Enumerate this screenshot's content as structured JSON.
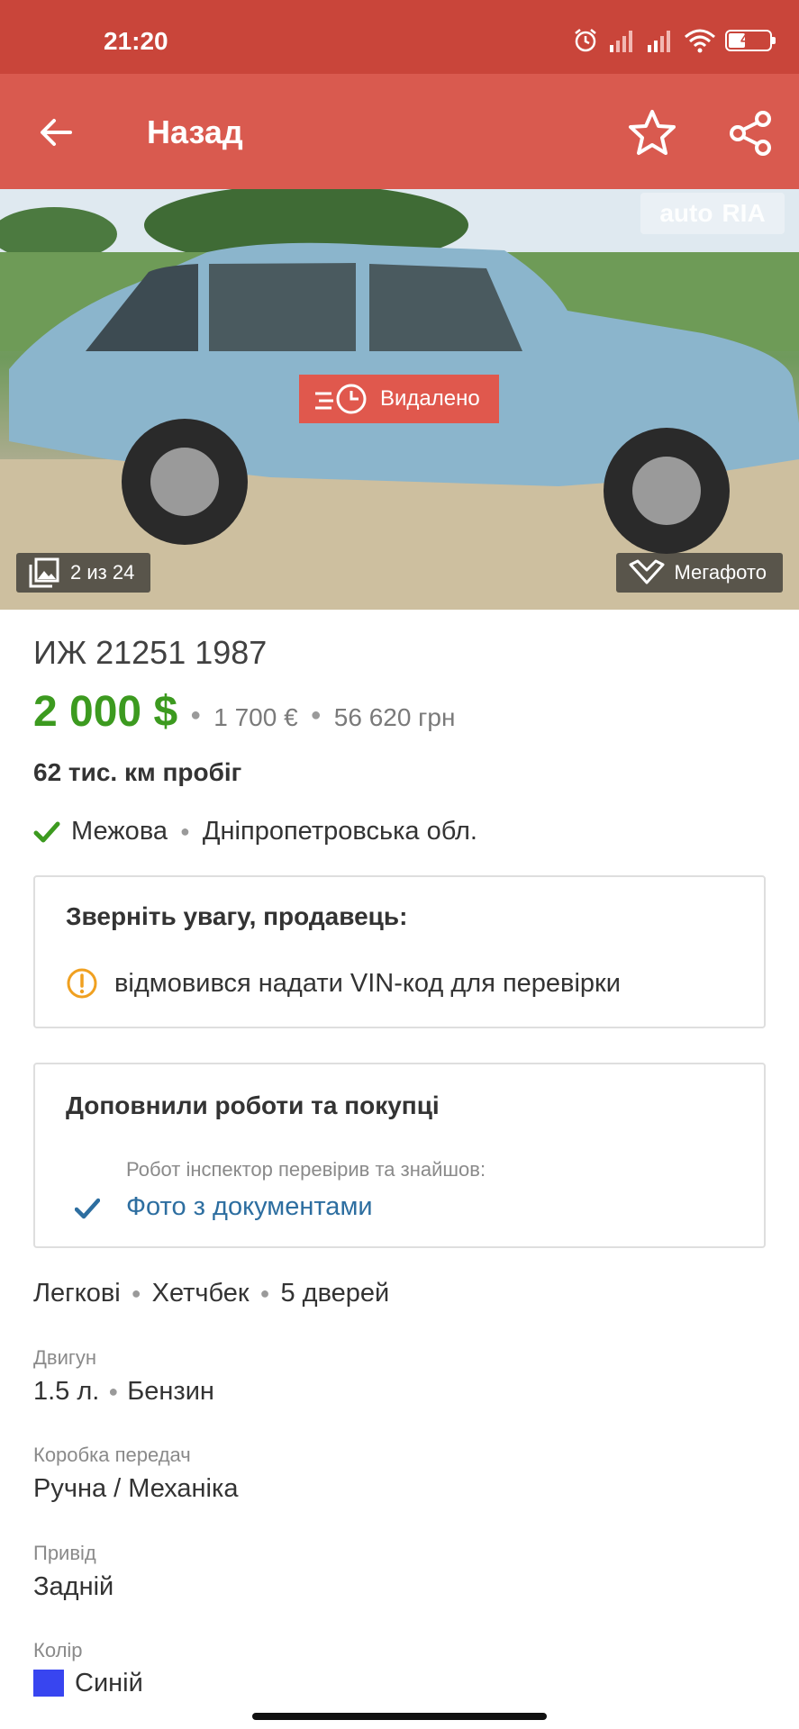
{
  "status_bar": {
    "time": "21:20",
    "battery": "41",
    "battery_level": 0.41
  },
  "app_bar": {
    "title": "Назад",
    "back_icon": "arrow-left-icon",
    "favorite_icon": "star-outline-icon",
    "share_icon": "share-icon"
  },
  "photo": {
    "watermark_left": "auto",
    "watermark_right": "RIA",
    "status_badge": "Видалено",
    "counter": "2 из 24",
    "megaphoto": "Мегафото"
  },
  "listing": {
    "title": "ИЖ 21251 1987",
    "price_main": "2 000 $",
    "price_eur": "1 700 €",
    "price_uah": "56 620 грн",
    "mileage": "62 тис. км пробіг",
    "city": "Межова",
    "region": "Дніпропетровська обл."
  },
  "seller_notice": {
    "heading": "Зверніть увагу, продавець:",
    "item": "відмовився надати VIN-код для перевірки"
  },
  "inspection": {
    "heading": "Доповнили роботи та покупці",
    "subtitle": "Робот інспектор перевірив та знайшов:",
    "link": "Фото з документами"
  },
  "specs": {
    "category": "Легкові",
    "body": "Хетчбек",
    "doors": "5 дверей",
    "engine_label": "Двигун",
    "engine_volume": "1.5 л.",
    "fuel": "Бензин",
    "gearbox_label": "Коробка передач",
    "gearbox": "Ручна / Механіка",
    "drive_label": "Привід",
    "drive": "Задній",
    "color_label": "Колір",
    "color": "Синій",
    "color_hex": "#3845f0"
  },
  "colors": {
    "status_bar": "#c9453a",
    "app_bar": "#d95a4f",
    "price": "#3c9a1f",
    "link": "#2d6ea0",
    "badge": "#e0584d"
  }
}
